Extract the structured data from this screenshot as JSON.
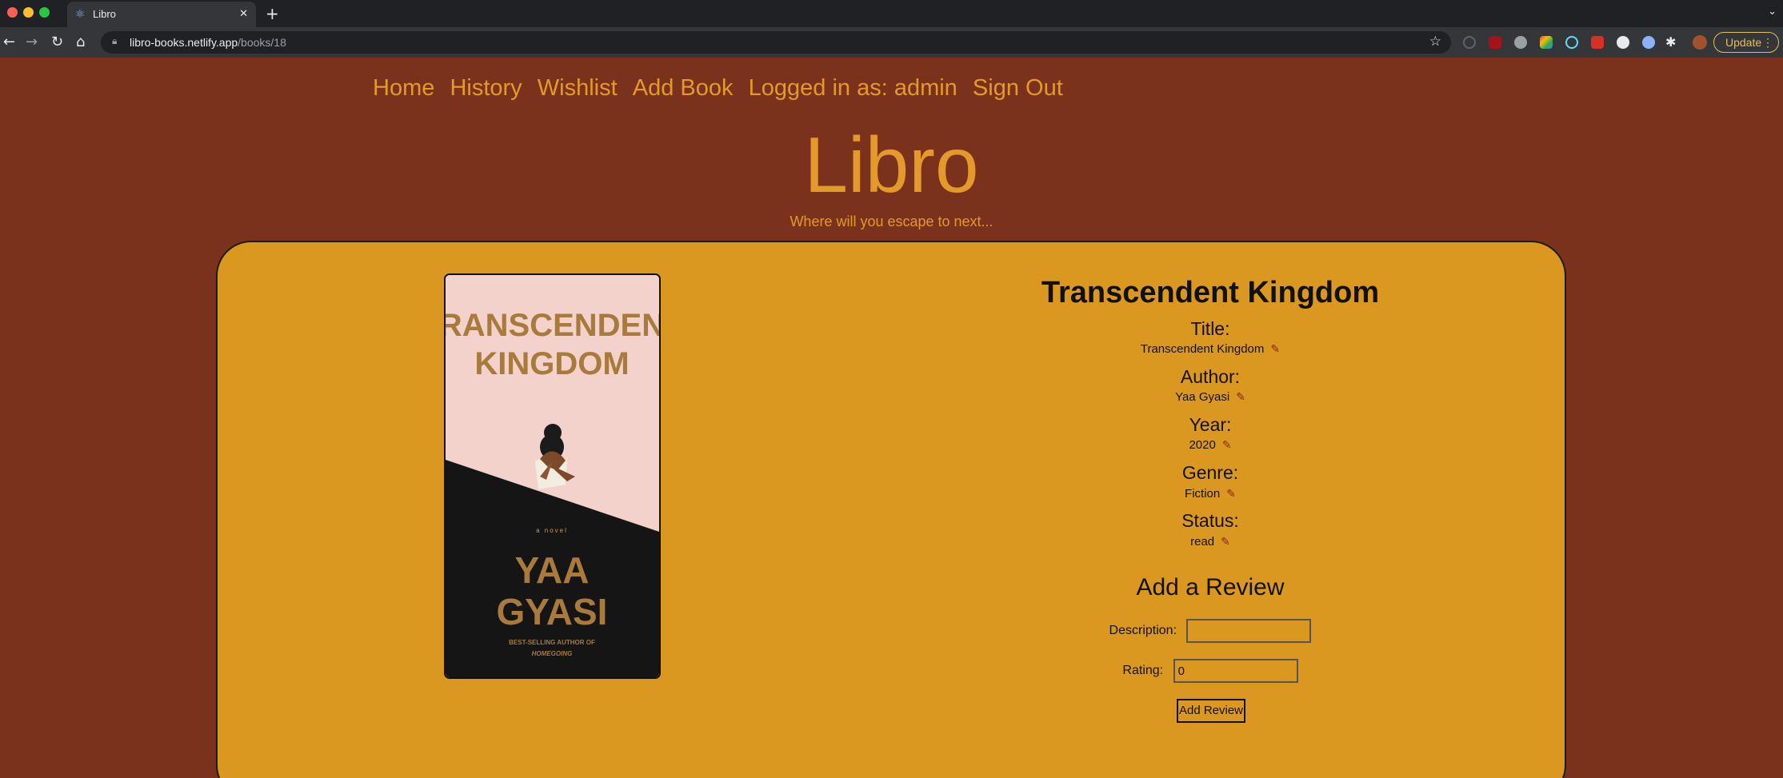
{
  "browser": {
    "tab_title": "Libro",
    "tab_close": "✕",
    "new_tab": "+",
    "url_host": "libro-books.netlify.app",
    "url_path": "/books/18",
    "update_label": "Update",
    "icons": [
      "react-favicon-icon",
      "back-icon",
      "forward-icon",
      "reload-icon",
      "home-icon",
      "lock-icon",
      "bookmark-star-icon",
      "extensions-puzzle-icon",
      "profile-avatar-icon"
    ]
  },
  "nav": {
    "home": "Home",
    "history": "History",
    "wishlist": "Wishlist",
    "add_book": "Add Book",
    "logged_in": "Logged in as: admin",
    "sign_out": "Sign Out"
  },
  "brand": {
    "title": "Libro",
    "tagline": "Where will you escape to next..."
  },
  "book": {
    "heading": "Transcendent Kingdom",
    "cover": {
      "title_line1": "TRANSCENDENT",
      "title_line2": "KINGDOM",
      "subtitle": "a novel",
      "author_line1": "YAA",
      "author_line2": "GYASI",
      "blurb_line1": "BEST-SELLING AUTHOR OF",
      "blurb_line2": "HOMEGOING"
    },
    "fields": {
      "title_label": "Title:",
      "title_value": "Transcendent Kingdom",
      "author_label": "Author:",
      "author_value": "Yaa Gyasi",
      "year_label": "Year:",
      "year_value": "2020",
      "genre_label": "Genre:",
      "genre_value": "Fiction",
      "status_label": "Status:",
      "status_value": "read"
    }
  },
  "review": {
    "heading": "Add a Review",
    "description_label": "Description:",
    "description_value": "",
    "rating_label": "Rating:",
    "rating_value": "0",
    "submit_label": "Add Review"
  },
  "colors": {
    "page_bg": "#7b321c",
    "accent": "#e4992b",
    "card_bg": "#db9821",
    "edit_icon": "#8a2616"
  }
}
